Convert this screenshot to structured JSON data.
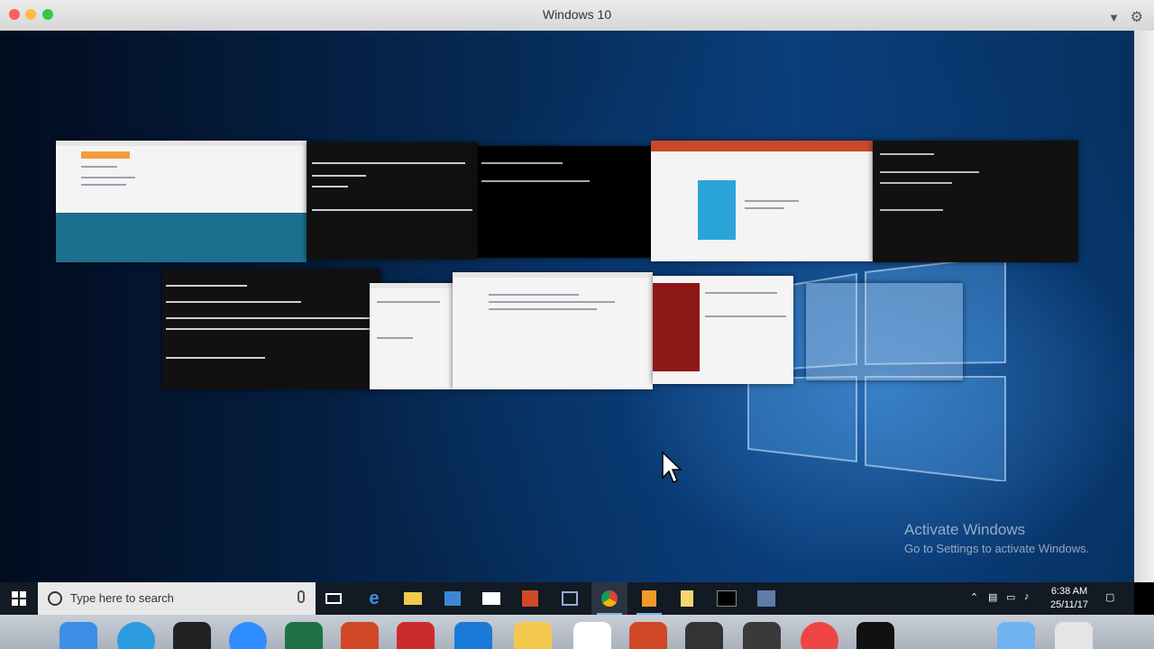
{
  "mac_window": {
    "title": "Windows 10",
    "controls": {
      "dropdown_icon": "chevron-down-icon",
      "settings_icon": "gear-icon"
    }
  },
  "desktop": {
    "watermark_title": "Activate Windows",
    "watermark_subtitle": "Go to Settings to activate Windows."
  },
  "task_view": {
    "top_row": [
      {
        "name": "chrome-presentation-window",
        "kind": "light"
      },
      {
        "name": "terminal-java-window",
        "kind": "dark"
      },
      {
        "name": "command-prompt-window",
        "kind": "black"
      },
      {
        "name": "powerpoint-window",
        "kind": "light"
      },
      {
        "name": "code-editor-window",
        "kind": "dark"
      }
    ],
    "bottom_row": [
      {
        "name": "ssh-terminal-window",
        "kind": "dark"
      },
      {
        "name": "control-panel-window",
        "kind": "light"
      },
      {
        "name": "file-explorer-window",
        "kind": "light"
      },
      {
        "name": "setup-wizard-window",
        "kind": "light"
      },
      {
        "name": "blank-window",
        "kind": "translucent"
      }
    ]
  },
  "taskbar": {
    "search_placeholder": "Type here to search",
    "apps": [
      "edge-icon",
      "file-explorer-icon",
      "store-icon",
      "mail-icon",
      "powerpoint-icon",
      "notepad-icon",
      "chrome-icon",
      "sublime-icon",
      "folder-icon",
      "terminal-icon",
      "network-icon"
    ],
    "clock": {
      "time": "6:38 AM",
      "date": "25/11/17"
    }
  },
  "dock": {
    "apps": [
      "finder-icon",
      "safari-icon",
      "terminal-icon",
      "zoom-icon",
      "excel-icon",
      "powerpoint-icon",
      "parallels-icon",
      "windows-icon",
      "folder-icon",
      "document-icon",
      "powerpoint-icon",
      "terminal-icon",
      "sublime-icon",
      "chrome-icon",
      "terminal-icon",
      "folder-icon",
      "trash-icon"
    ]
  }
}
